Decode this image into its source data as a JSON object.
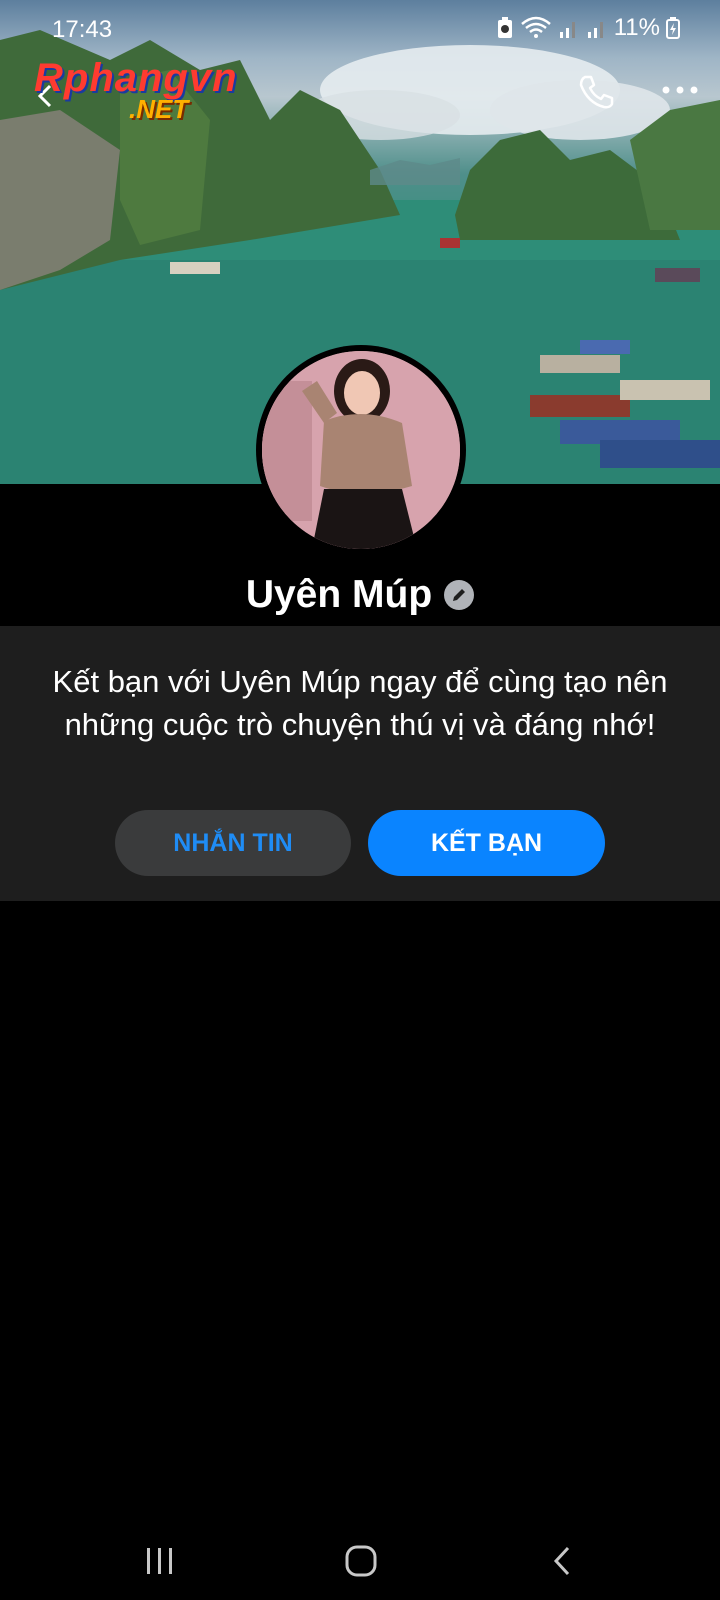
{
  "status_bar": {
    "time": "17:43",
    "battery": "11%"
  },
  "header": {
    "logo_text_main": "Rphangvn",
    "logo_text_sub": ".NET"
  },
  "profile": {
    "name": "Uyên Múp"
  },
  "friend_prompt": {
    "text": "Kết bạn với Uyên Múp ngay để cùng tạo nên những cuộc trò chuyện thú vị và đáng nhớ!",
    "message_label": "NHẮN TIN",
    "add_friend_label": "KẾT BẠN"
  },
  "colors": {
    "accent": "#0a84ff",
    "panel": "#1e1e1e",
    "secondary_button": "#3a3b3c"
  }
}
